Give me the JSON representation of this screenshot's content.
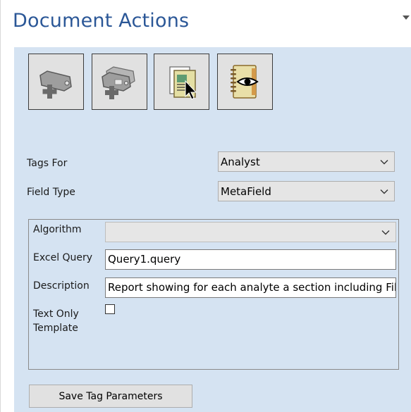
{
  "header": {
    "title": "Document Actions"
  },
  "toolbar": {
    "buttons": [
      {
        "icon": "add-tag-icon"
      },
      {
        "icon": "add-multiple-tags-icon"
      },
      {
        "icon": "select-document-icon"
      },
      {
        "icon": "view-notebook-icon"
      }
    ]
  },
  "form": {
    "tags_for": {
      "label": "Tags For",
      "value": "Analyst"
    },
    "field_type": {
      "label": "Field Type",
      "value": "MetaField"
    }
  },
  "params": {
    "algorithm": {
      "label": "Algorithm",
      "value": ""
    },
    "excel_query": {
      "label": "Excel Query",
      "value": "Query1.query"
    },
    "description": {
      "label": "Description",
      "value": "Report showing for each analyte a section including File In"
    },
    "text_only": {
      "label_line1": "Text Only",
      "label_line2": "Template",
      "checked": false
    }
  },
  "actions": {
    "save_label": "Save Tag Parameters"
  },
  "colors": {
    "panel": "#d5e3f2",
    "title": "#2b5797"
  }
}
